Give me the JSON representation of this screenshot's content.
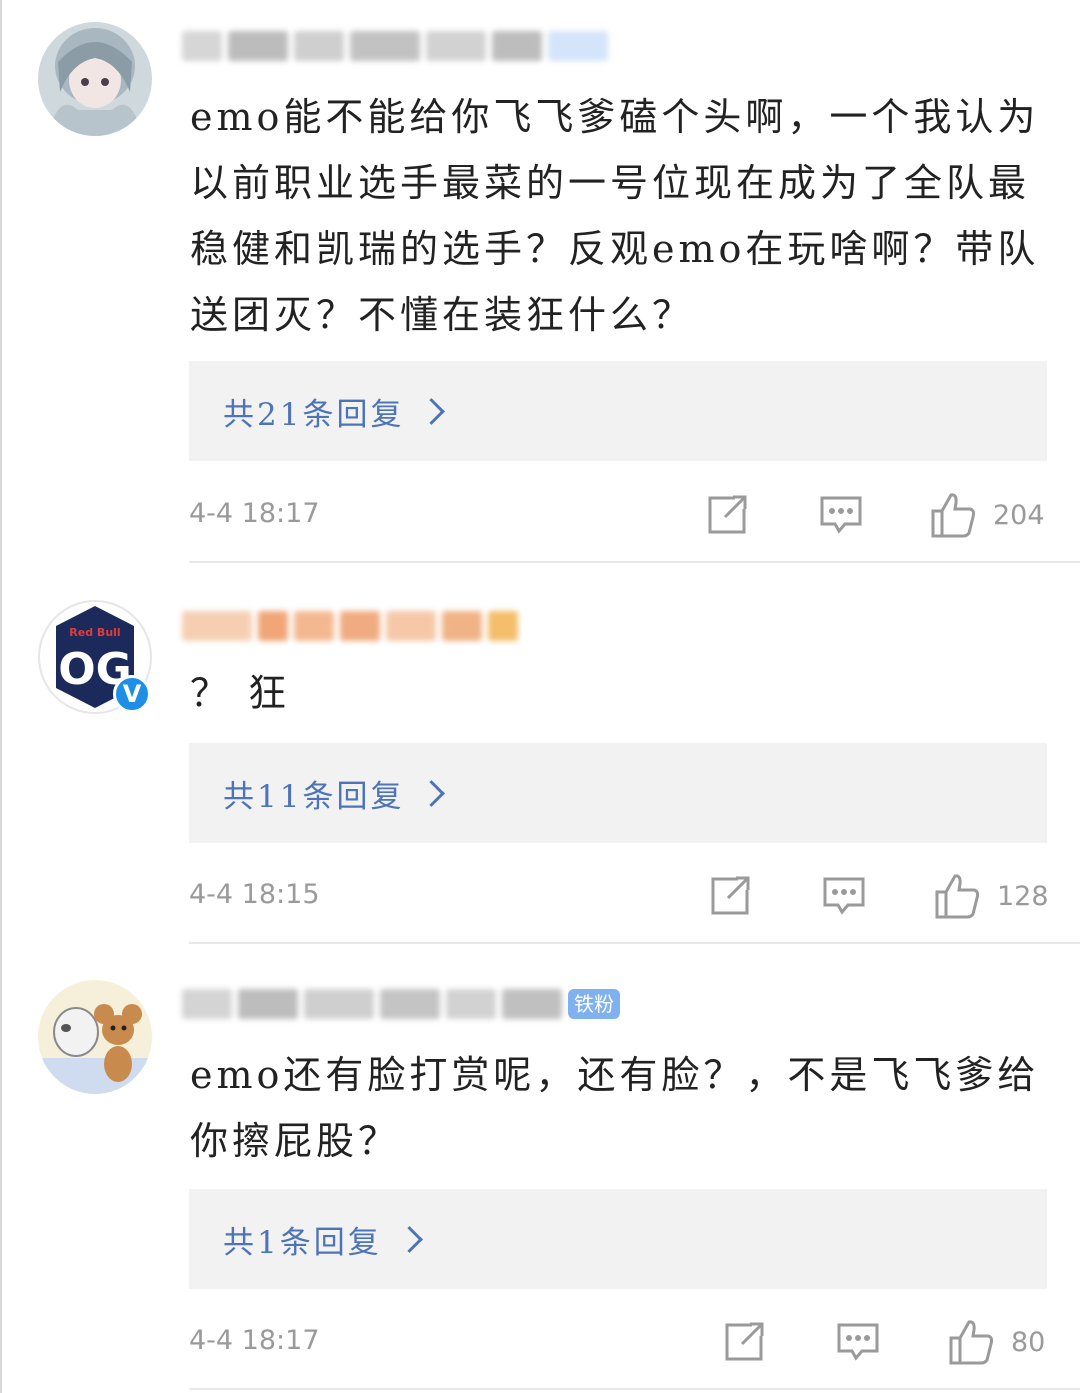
{
  "comments": [
    {
      "text": "emo能不能给你飞飞爹磕个头啊，一个我认为以前职业选手最菜的一号位现在成为了全队最稳健和凯瑞的选手？反观emo在玩啥啊？带队送团灭？不懂在装狂什么？",
      "reply_label": "共21条回复",
      "time": "4-4 18:17",
      "likes": "204",
      "avatar_icon": "anime-girl-avatar",
      "verified": false
    },
    {
      "text": "？ 狂",
      "reply_label": "共11条回复",
      "time": "4-4 18:15",
      "likes": "128",
      "avatar_icon": "og-team-logo",
      "avatar_text": "OG",
      "avatar_brand": "Red Bull",
      "verified": true,
      "verified_mark": "V"
    },
    {
      "text": "emo还有脸打赏呢，还有脸？，不是飞飞爹给你擦屁股？",
      "reply_label": "共1条回复",
      "time": "4-4 18:17",
      "likes": "80",
      "avatar_icon": "tom-and-jerry-avatar",
      "badge": "铁粉",
      "verified": false
    }
  ],
  "colors": {
    "link": "#4d74b6",
    "reply_bg": "#f2f2f2",
    "meta": "#9a9a9a",
    "text": "#222222",
    "badge": "#7fb0f0",
    "verified": "#1e8fe6"
  },
  "icons": [
    "share-icon",
    "comment-icon",
    "like-icon",
    "chevron-right-icon"
  ]
}
